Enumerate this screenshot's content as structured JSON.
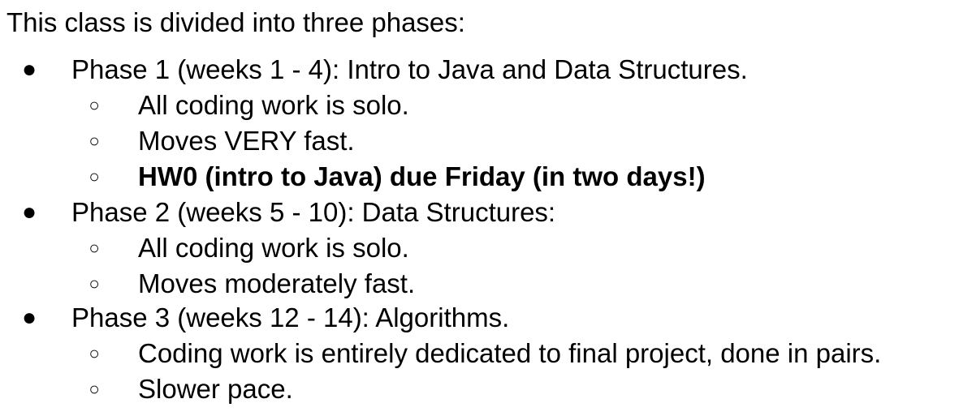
{
  "intro": "This class is divided into three phases:",
  "phases": [
    {
      "bullet": "●",
      "text": "Phase 1 (weeks 1 - 4): Intro to Java and Data Structures.",
      "items": [
        {
          "bullet": "○",
          "text": "All coding work is solo."
        },
        {
          "bullet": "○",
          "text": "Moves VERY fast."
        },
        {
          "bullet": "○",
          "text": "HW0 (intro to Java) due Friday (in two days!)"
        }
      ]
    },
    {
      "bullet": "●",
      "text": "Phase 2 (weeks 5 - 10): Data Structures:",
      "items": [
        {
          "bullet": "○",
          "text": "All coding work is solo."
        },
        {
          "bullet": "○",
          "text": "Moves moderately fast."
        }
      ]
    },
    {
      "bullet": "●",
      "text": "Phase 3 (weeks 12 - 14): Algorithms.",
      "items": [
        {
          "bullet": "○",
          "text": "Coding work is entirely dedicated to final project, done in pairs."
        },
        {
          "bullet": "○",
          "text": "Slower pace."
        }
      ]
    }
  ]
}
